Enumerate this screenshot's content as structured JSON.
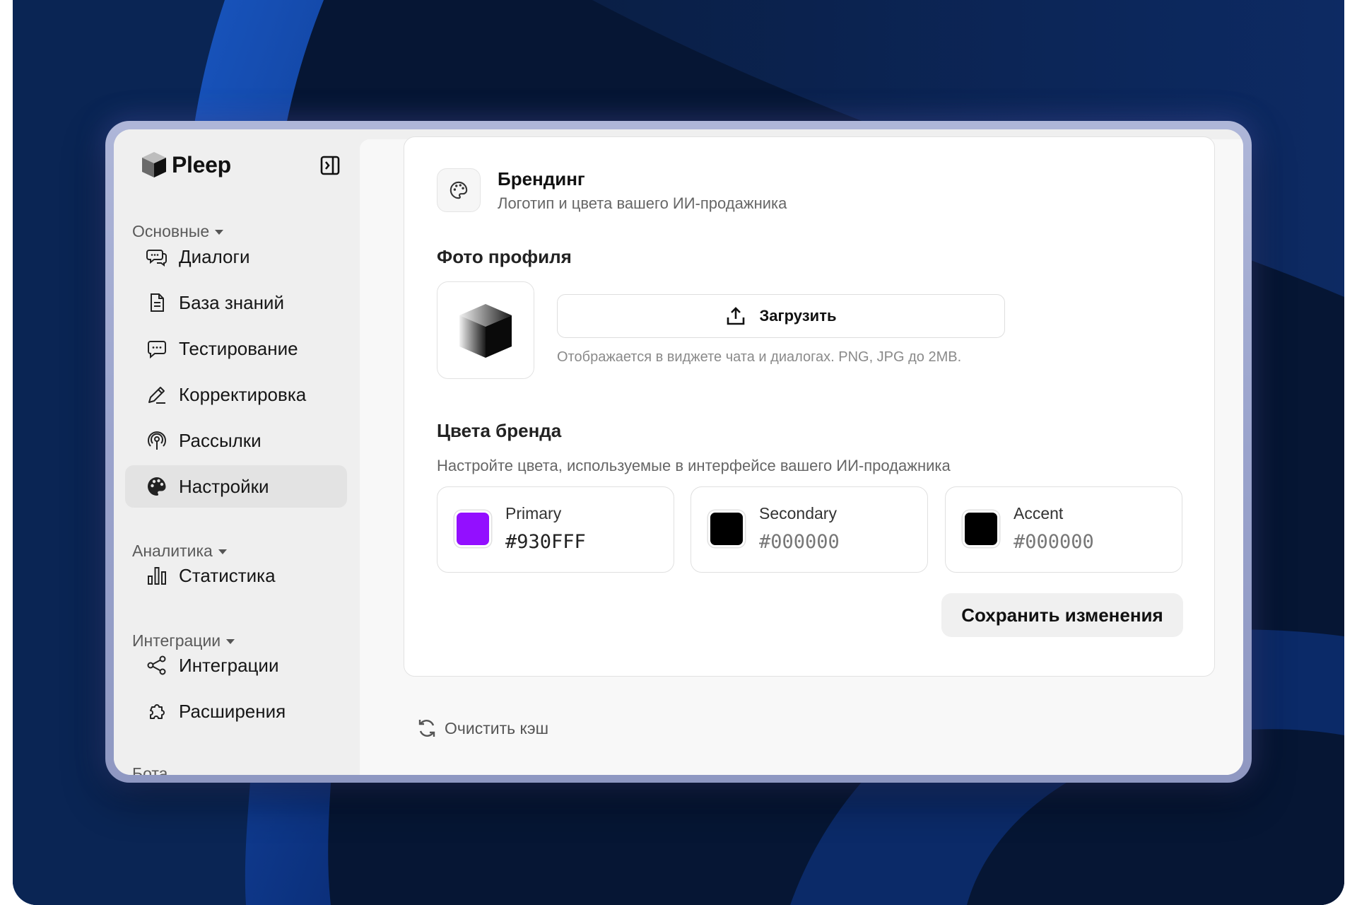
{
  "app": {
    "name": "Pleep"
  },
  "sidebar": {
    "sections": [
      {
        "label": "Основные"
      },
      {
        "label": "Аналитика"
      },
      {
        "label": "Интеграции"
      }
    ],
    "items": [
      {
        "label": "Диалоги",
        "icon": "chat-bubbles-icon"
      },
      {
        "label": "База знаний",
        "icon": "document-icon"
      },
      {
        "label": "Тестирование",
        "icon": "message-dots-icon"
      },
      {
        "label": "Корректировка",
        "icon": "pencil-icon"
      },
      {
        "label": "Рассылки",
        "icon": "broadcast-icon"
      },
      {
        "label": "Настройки",
        "icon": "palette-icon",
        "active": true
      },
      {
        "label": "Статистика",
        "icon": "bar-chart-icon"
      },
      {
        "label": "Интеграции",
        "icon": "share-nodes-icon"
      },
      {
        "label": "Расширения",
        "icon": "puzzle-icon"
      }
    ],
    "cut_off_label": "Бота"
  },
  "branding": {
    "title": "Брендинг",
    "subtitle": "Логотип и цвета вашего ИИ-продажника",
    "profile_photo": {
      "heading": "Фото профиля",
      "upload_label": "Загрузить",
      "hint": "Отображается в виджете чата и диалогах. PNG, JPG до 2MB."
    },
    "brand_colors": {
      "heading": "Цвета бренда",
      "description": "Настройте цвета, используемые в интерфейсе вашего ИИ-продажника",
      "colors": [
        {
          "name": "Primary",
          "hex": "#930FFF"
        },
        {
          "name": "Secondary",
          "hex": "#000000"
        },
        {
          "name": "Accent",
          "hex": "#000000"
        }
      ]
    },
    "save_label": "Сохранить изменения"
  },
  "footer": {
    "clear_cache_label": "Очистить кэш"
  },
  "colors": {
    "primary": "#930FFF",
    "secondary": "#000000",
    "accent": "#000000",
    "background": "#071a3a"
  }
}
